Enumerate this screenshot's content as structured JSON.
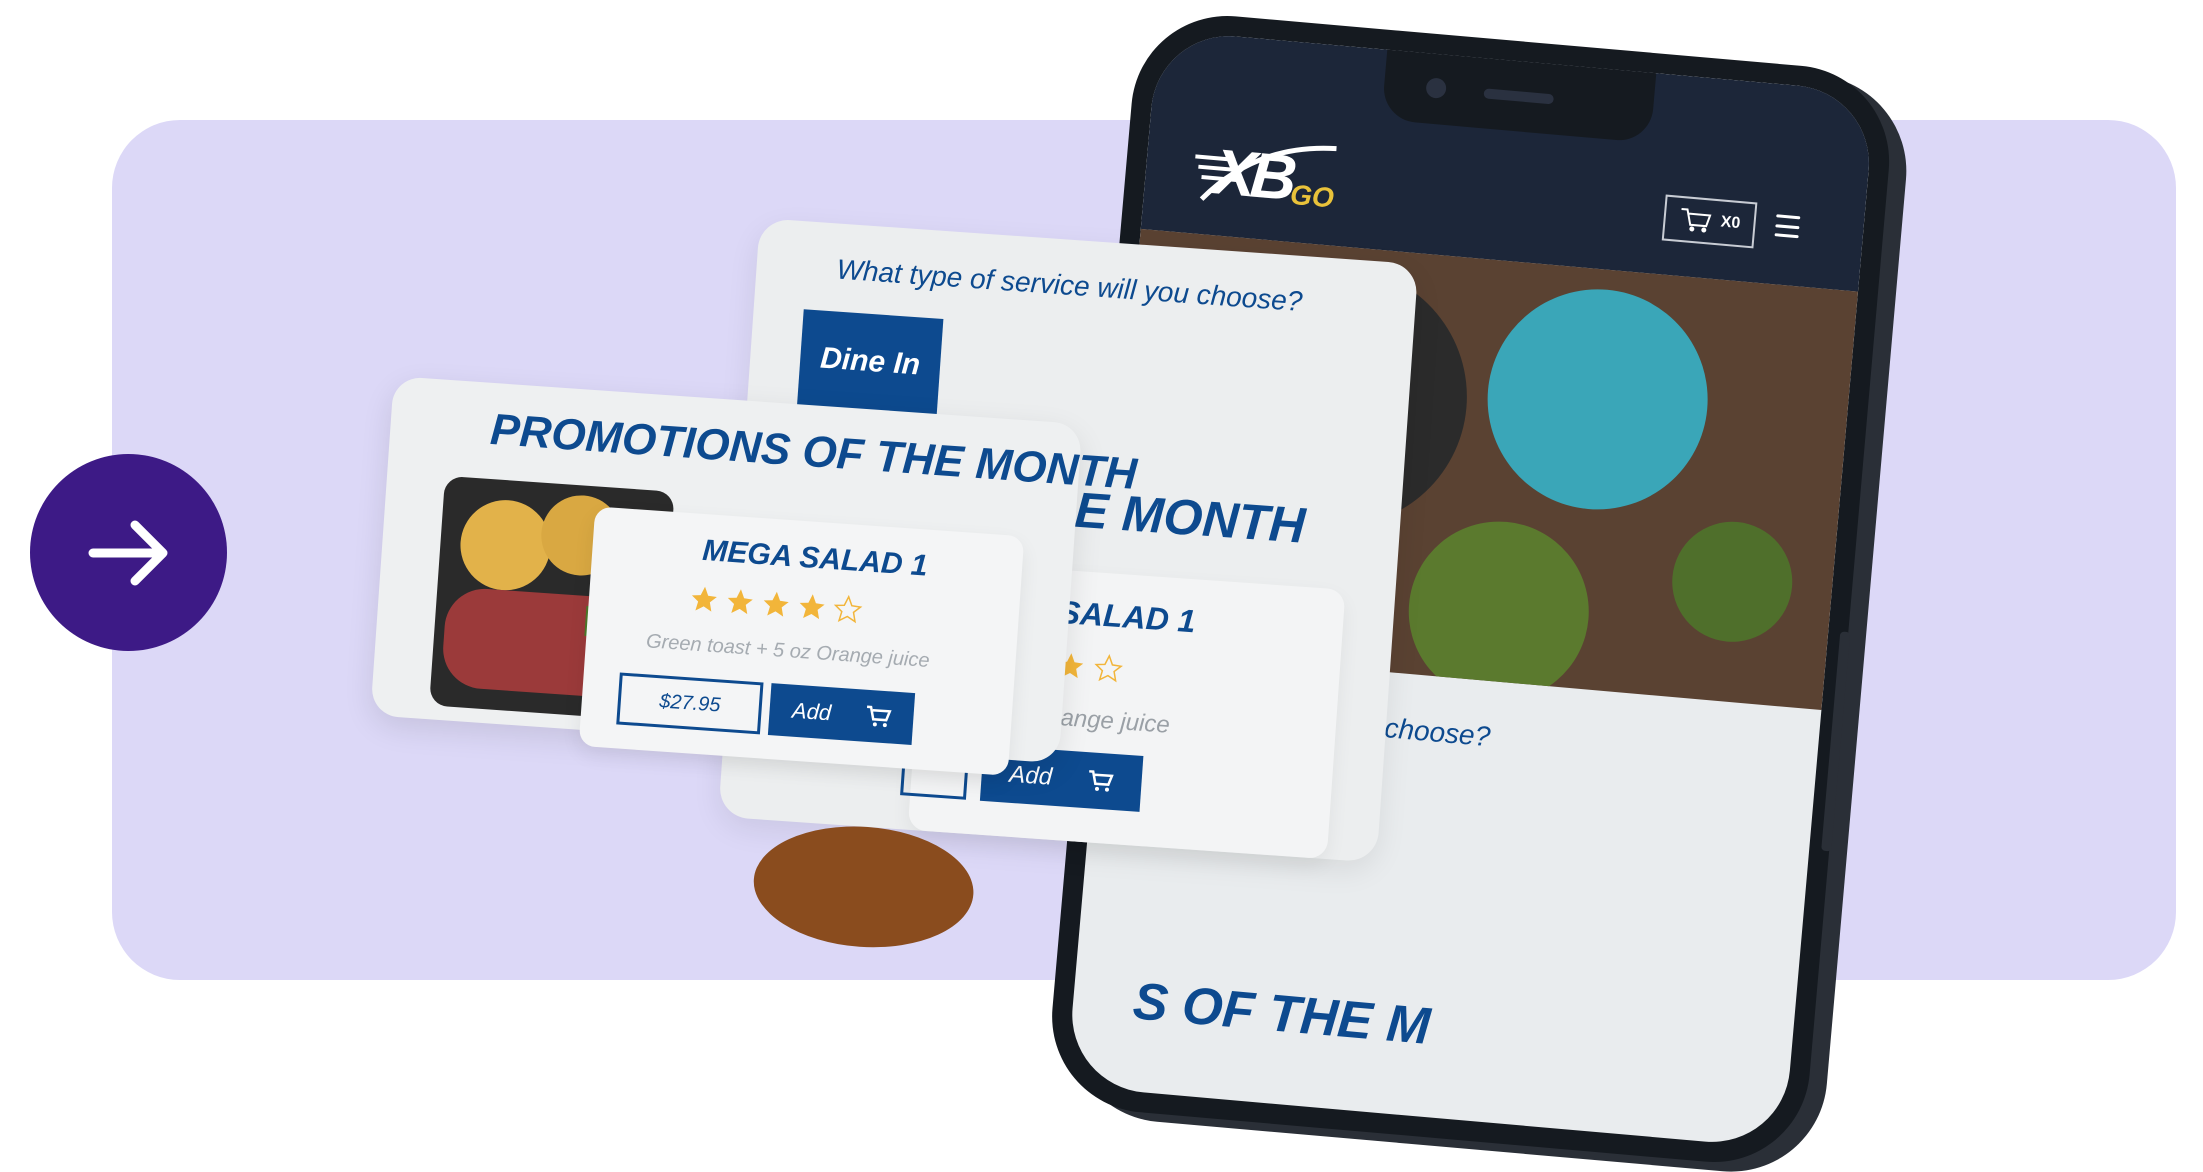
{
  "app": {
    "logo_text": "XB",
    "logo_suffix": "GO",
    "cart_count": "X0"
  },
  "service": {
    "question": "What type of service will you choose?",
    "dine_in_label": "Dine In"
  },
  "promotions": {
    "heading": "PROMOTIONS OF THE MONTH",
    "heading_partial": "THE MONTH",
    "heading_screen_partial": "S OF THE M",
    "question_partial": "rvice will you choose?"
  },
  "product": {
    "name": "MEGA SALAD 1",
    "name_partial": "GA SALAD 1",
    "description": "Green toast + 5 oz Orange juice",
    "description_partial": "st + 5 oz Orange juice",
    "price": "$27.95",
    "add_label": "Add",
    "rating": 4,
    "rating_max": 5
  },
  "colors": {
    "brand_blue": "#0d4a8f",
    "header_navy": "#1c2639",
    "accent_gold": "#e9c23a",
    "cta_purple": "#3d1a86",
    "panel_lavender": "#dcd8f7"
  },
  "icons": [
    "arrow-right-icon",
    "cart-icon",
    "menu-icon",
    "star-icon"
  ]
}
